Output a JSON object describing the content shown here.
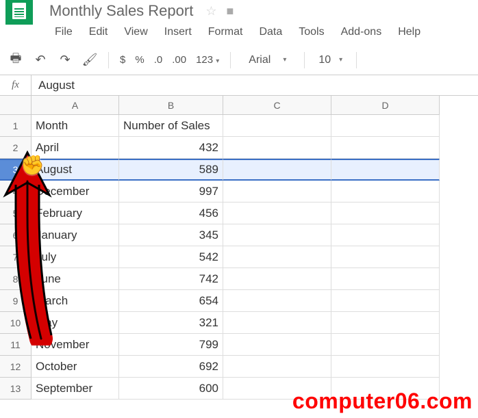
{
  "doc": {
    "title": "Monthly Sales Report"
  },
  "menubar": [
    "File",
    "Edit",
    "View",
    "Insert",
    "Format",
    "Data",
    "Tools",
    "Add-ons",
    "Help"
  ],
  "toolbar": {
    "currency": "$",
    "percent": "%",
    "dec_dec": ".0",
    "inc_dec": ".00",
    "fmt": "123",
    "font": "Arial",
    "size": "10"
  },
  "formula": {
    "fx": "fx",
    "value": "August"
  },
  "columns": [
    "A",
    "B",
    "C",
    "D"
  ],
  "headers": {
    "colA": "Month",
    "colB": "Number of Sales"
  },
  "rows": [
    {
      "n": "1",
      "a": "Month",
      "b": "Number of Sales",
      "isHeader": true
    },
    {
      "n": "2",
      "a": "April",
      "b": "432"
    },
    {
      "n": "3",
      "a": "August",
      "b": "589",
      "selected": true
    },
    {
      "n": "4",
      "a": "December",
      "b": "997"
    },
    {
      "n": "5",
      "a": "February",
      "b": "456"
    },
    {
      "n": "6",
      "a": "January",
      "b": "345"
    },
    {
      "n": "7",
      "a": "July",
      "b": "542"
    },
    {
      "n": "8",
      "a": "June",
      "b": "742"
    },
    {
      "n": "9",
      "a": "March",
      "b": "654"
    },
    {
      "n": "10",
      "a": "May",
      "b": "321"
    },
    {
      "n": "11",
      "a": "November",
      "b": "799"
    },
    {
      "n": "12",
      "a": "October",
      "b": "692"
    },
    {
      "n": "13",
      "a": "September",
      "b": "600"
    }
  ],
  "watermark": "computer06.com"
}
